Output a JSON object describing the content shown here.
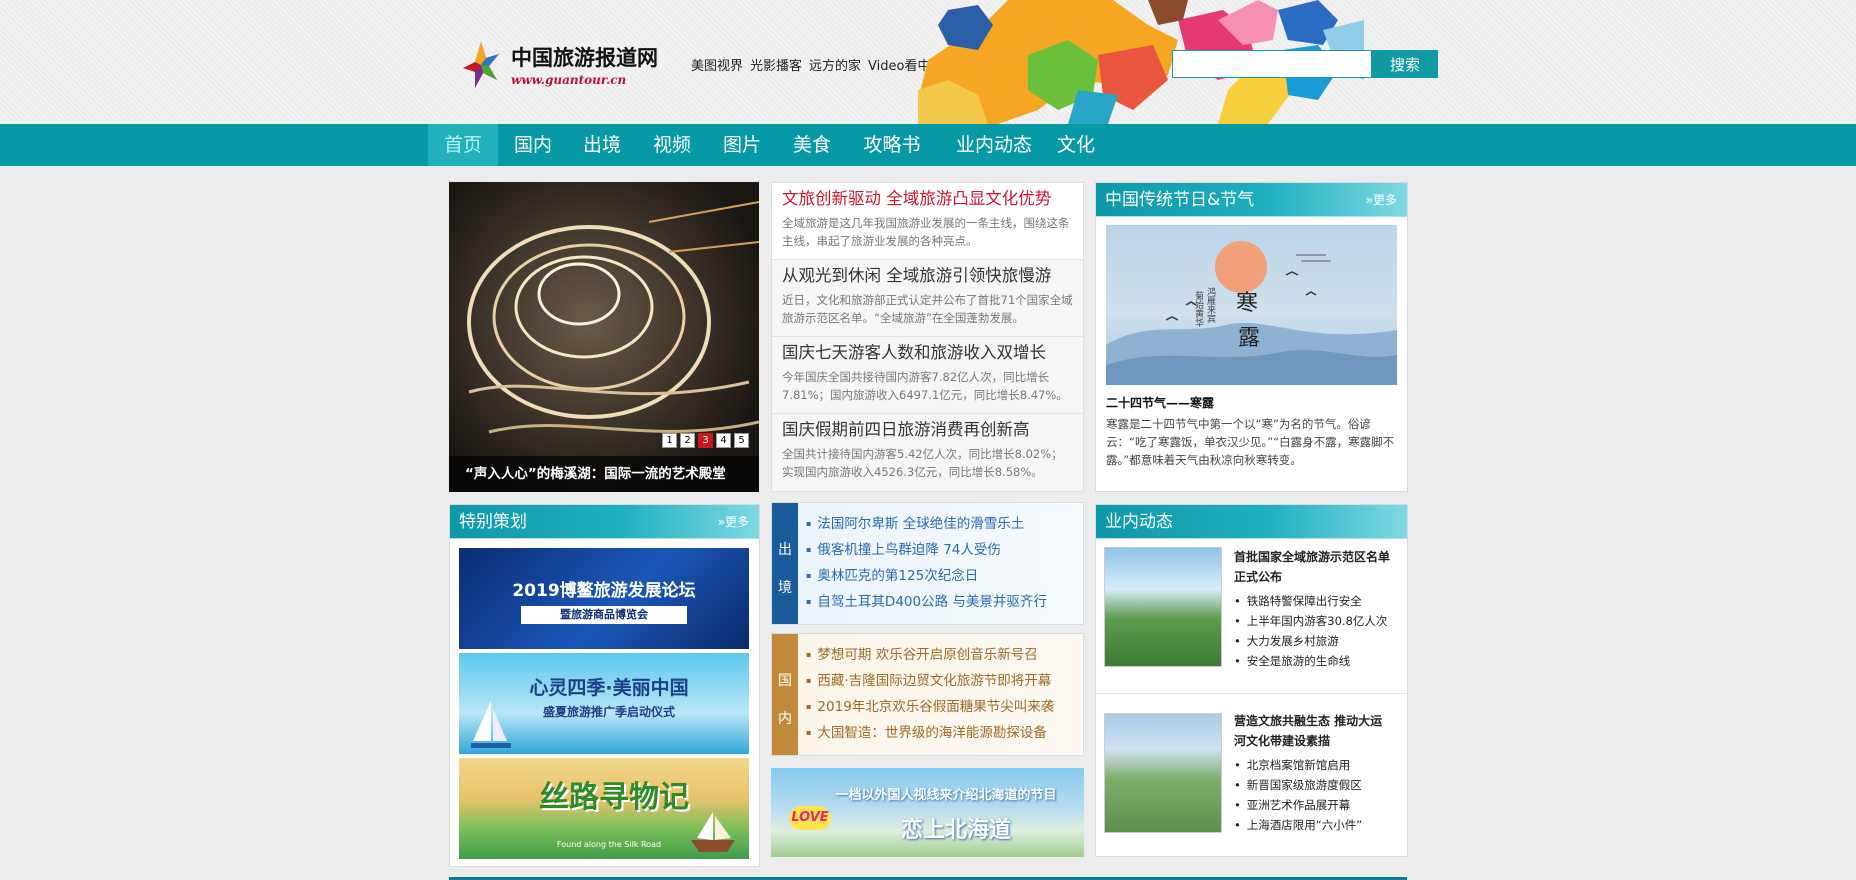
{
  "site": {
    "name": "中国旅游报道网",
    "url": "www.guantour.cn"
  },
  "top_links": [
    "美图视界",
    "光影播客",
    "远方的家",
    "Video看中国"
  ],
  "search": {
    "placeholder": "",
    "button": "搜索"
  },
  "nav": [
    {
      "label": "首页",
      "active": true
    },
    {
      "label": "国内"
    },
    {
      "label": "出境"
    },
    {
      "label": "视频"
    },
    {
      "label": "图片"
    },
    {
      "label": "美食"
    },
    {
      "label": "攻略书"
    },
    {
      "label": "业内动态"
    },
    {
      "label": "文化"
    }
  ],
  "slider": {
    "caption": "“声入人心”的梅溪湖：国际一流的艺术殿堂",
    "pages": [
      "1",
      "2",
      "3",
      "4",
      "5"
    ],
    "active_page": 3
  },
  "headlines": [
    {
      "title": "文旅创新驱动 全域旅游凸显文化优势",
      "desc": "全域旅游是这几年我国旅游业发展的一条主线，围绕这条主线，串起了旅游业发展的各种亮点。"
    },
    {
      "title": "从观光到休闲 全域旅游引领快旅慢游",
      "desc": "近日，文化和旅游部正式认定并公布了首批71个国家全域旅游示范区名单。“全域旅游”在全国蓬勃发展。"
    },
    {
      "title": "国庆七天游客人数和旅游收入双增长",
      "desc": "今年国庆全国共接待国内游客7.82亿人次，同比增长7.81%；国内旅游收入6497.1亿元，同比增长8.47%。"
    },
    {
      "title": "国庆假期前四日旅游消费再创新高",
      "desc": "全国共计接待国内游客5.42亿人次，同比增长8.02%；实现国内旅游收入4526.3亿元，同比增长8.58%。"
    }
  ],
  "festival": {
    "title": "中国传统节日&节气",
    "more": "»更多",
    "image_text": {
      "big1": "寒",
      "big2": "露",
      "small1": "鸿雁来宾",
      "small2": "菊始黄华"
    },
    "caption": "二十四节气——寒露",
    "desc": "寒露是二十四节气中第一个以“寒”为名的节气。俗谚云：“吃了寒露饭，单衣汉少见。”“白露身不露，寒露脚不露。”都意味着天气由秋凉向秋寒转变。"
  },
  "special": {
    "title": "特别策划",
    "more": "»更多",
    "banners": [
      {
        "line1": "2019博鳌旅游发展论坛",
        "line2": "暨旅游商品博览会"
      },
      {
        "line1": "心灵四季·美丽中国",
        "line2": "盛夏旅游推广季启动仪式"
      },
      {
        "line1": "丝路寻物记",
        "line2": "Found along the Silk Road"
      }
    ]
  },
  "tabs": {
    "outbound": {
      "label": "出境",
      "items": [
        "法国阿尔卑斯 全球绝佳的滑雪乐土",
        "俄客机撞上鸟群迫降 74人受伤",
        "奥林匹克的第125次纪念日",
        "自驾土耳其D400公路 与美景并驱齐行"
      ]
    },
    "domestic": {
      "label": "国内",
      "items": [
        "梦想可期 欢乐谷开启原创音乐新号召",
        "西藏·吉隆国际边贸文化旅游节即将开幕",
        "2019年北京欢乐谷假面糖果节尖叫来袭",
        "大国智造：世界级的海洋能源勘探设备"
      ]
    }
  },
  "ad": {
    "top": "一档以外国人视线来介绍北海道的节目",
    "bottom": "恋上北海道",
    "badge": "LOVE"
  },
  "industry": {
    "title": "业内动态",
    "items": [
      {
        "headline": "首批国家全域旅游示范区名单正式公布",
        "bullets": [
          "铁路特警保障出行安全",
          "上半年国内游客30.8亿人次",
          "大力发展乡村旅游",
          "安全是旅游的生命线"
        ]
      },
      {
        "headline": "营造文旅共融生态 推动大运河文化带建设素描",
        "bullets": [
          "北京档案馆新馆启用",
          "新晋国家级旅游度假区",
          "亚洲艺术作品展开幕",
          "上海酒店限用“六小件”"
        ]
      }
    ]
  },
  "colors": {
    "nav": "#0799a5",
    "accent": "#129aa4",
    "headline_red": "#d0152c",
    "outbound_tab": "#1a5b9a",
    "domestic_tab": "#c08a3a"
  }
}
